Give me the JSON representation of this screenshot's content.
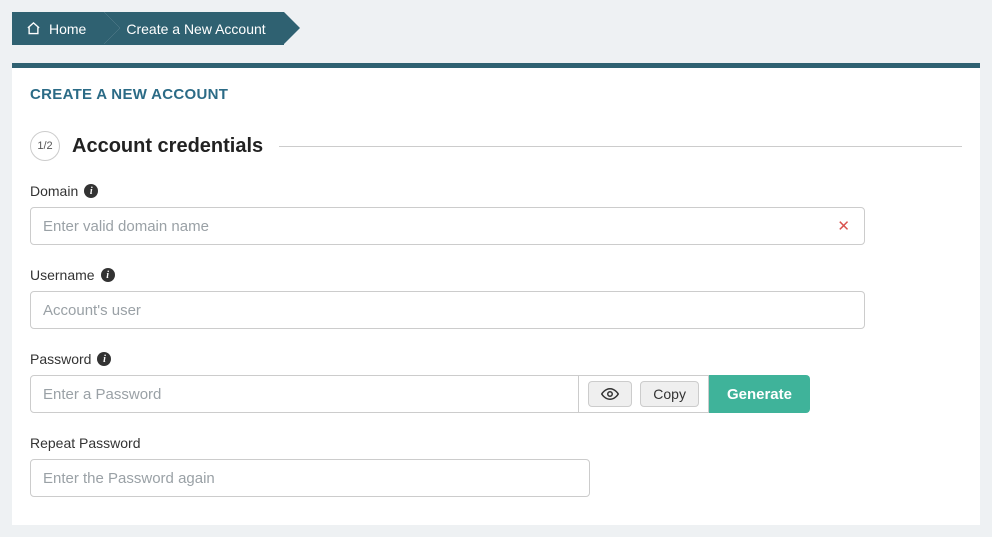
{
  "breadcrumb": {
    "home": "Home",
    "current": "Create a New Account"
  },
  "card": {
    "title": "CREATE A NEW ACCOUNT",
    "step_indicator": "1/2",
    "section_title": "Account credentials"
  },
  "fields": {
    "domain": {
      "label": "Domain",
      "placeholder": "Enter valid domain name"
    },
    "username": {
      "label": "Username",
      "placeholder": "Account's user"
    },
    "password": {
      "label": "Password",
      "placeholder": "Enter a Password"
    },
    "repeat_password": {
      "label": "Repeat Password",
      "placeholder": "Enter the Password again"
    }
  },
  "buttons": {
    "copy": "Copy",
    "generate": "Generate"
  }
}
